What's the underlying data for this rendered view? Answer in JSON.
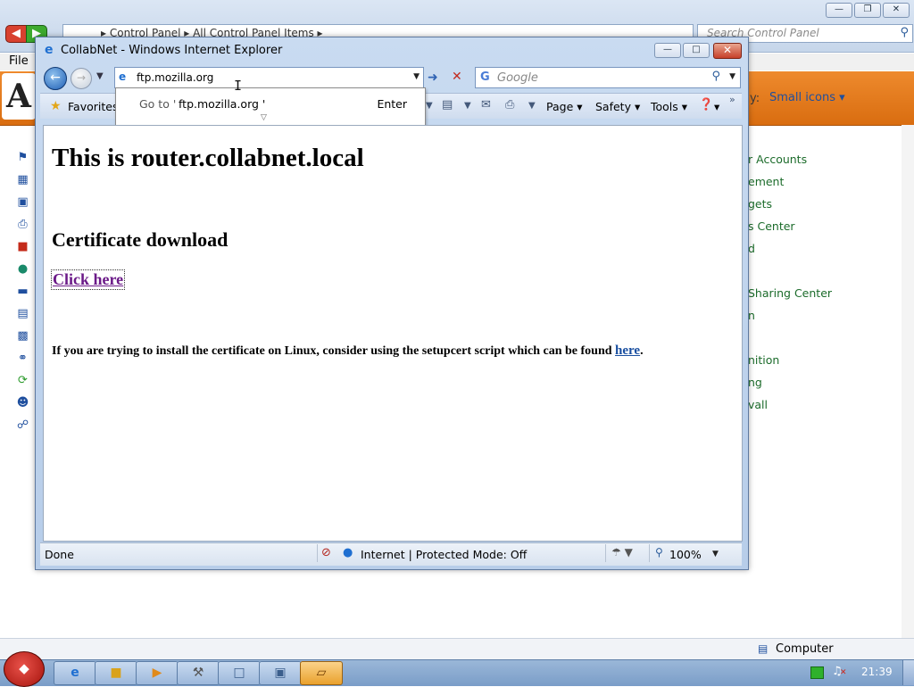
{
  "control_panel": {
    "breadcrumb": [
      "Control Panel",
      "All Control Panel Items"
    ],
    "search_placeholder": "Search Control Panel",
    "menu_file": "File",
    "view_by_label": "y:",
    "view_by_value": "Small icons ▾",
    "right_links": [
      "r Accounts",
      "ement",
      "gets",
      "s Center",
      "d",
      "Sharing Center",
      "n",
      "nition",
      "ng",
      "vall"
    ],
    "details_pane": "Computer"
  },
  "browser": {
    "title": "CollabNet - Windows Internet Explorer",
    "address": "ftp.mozilla.org",
    "search_placeholder": "Google",
    "autocomplete": {
      "prefix": "Go to '",
      "url": "ftp.mozilla.org '",
      "key": "Enter"
    },
    "toolbar": {
      "favorites": "Favorites",
      "page": "Page ▾",
      "safety": "Safety ▾",
      "tools": "Tools ▾",
      "help_drop": "▾"
    },
    "content": {
      "heading": "This is router.collabnet.local",
      "subheading": "Certificate download",
      "link": "Click here",
      "paragraph": "If you are trying to install the certificate on Linux, consider using the setupcert script which can be found",
      "paragraph_link": "here",
      "paragraph_end": "."
    },
    "status": {
      "text": "Done",
      "zone": "Internet | Protected Mode: Off",
      "zoom": "100%"
    }
  },
  "taskbar": {
    "clock": "21:39"
  },
  "colors": {
    "control_panel_accent": "#e07a1f",
    "link_visited": "#6b1a88",
    "link": "#1a4fa0",
    "cp_link": "#1b6b2a"
  }
}
